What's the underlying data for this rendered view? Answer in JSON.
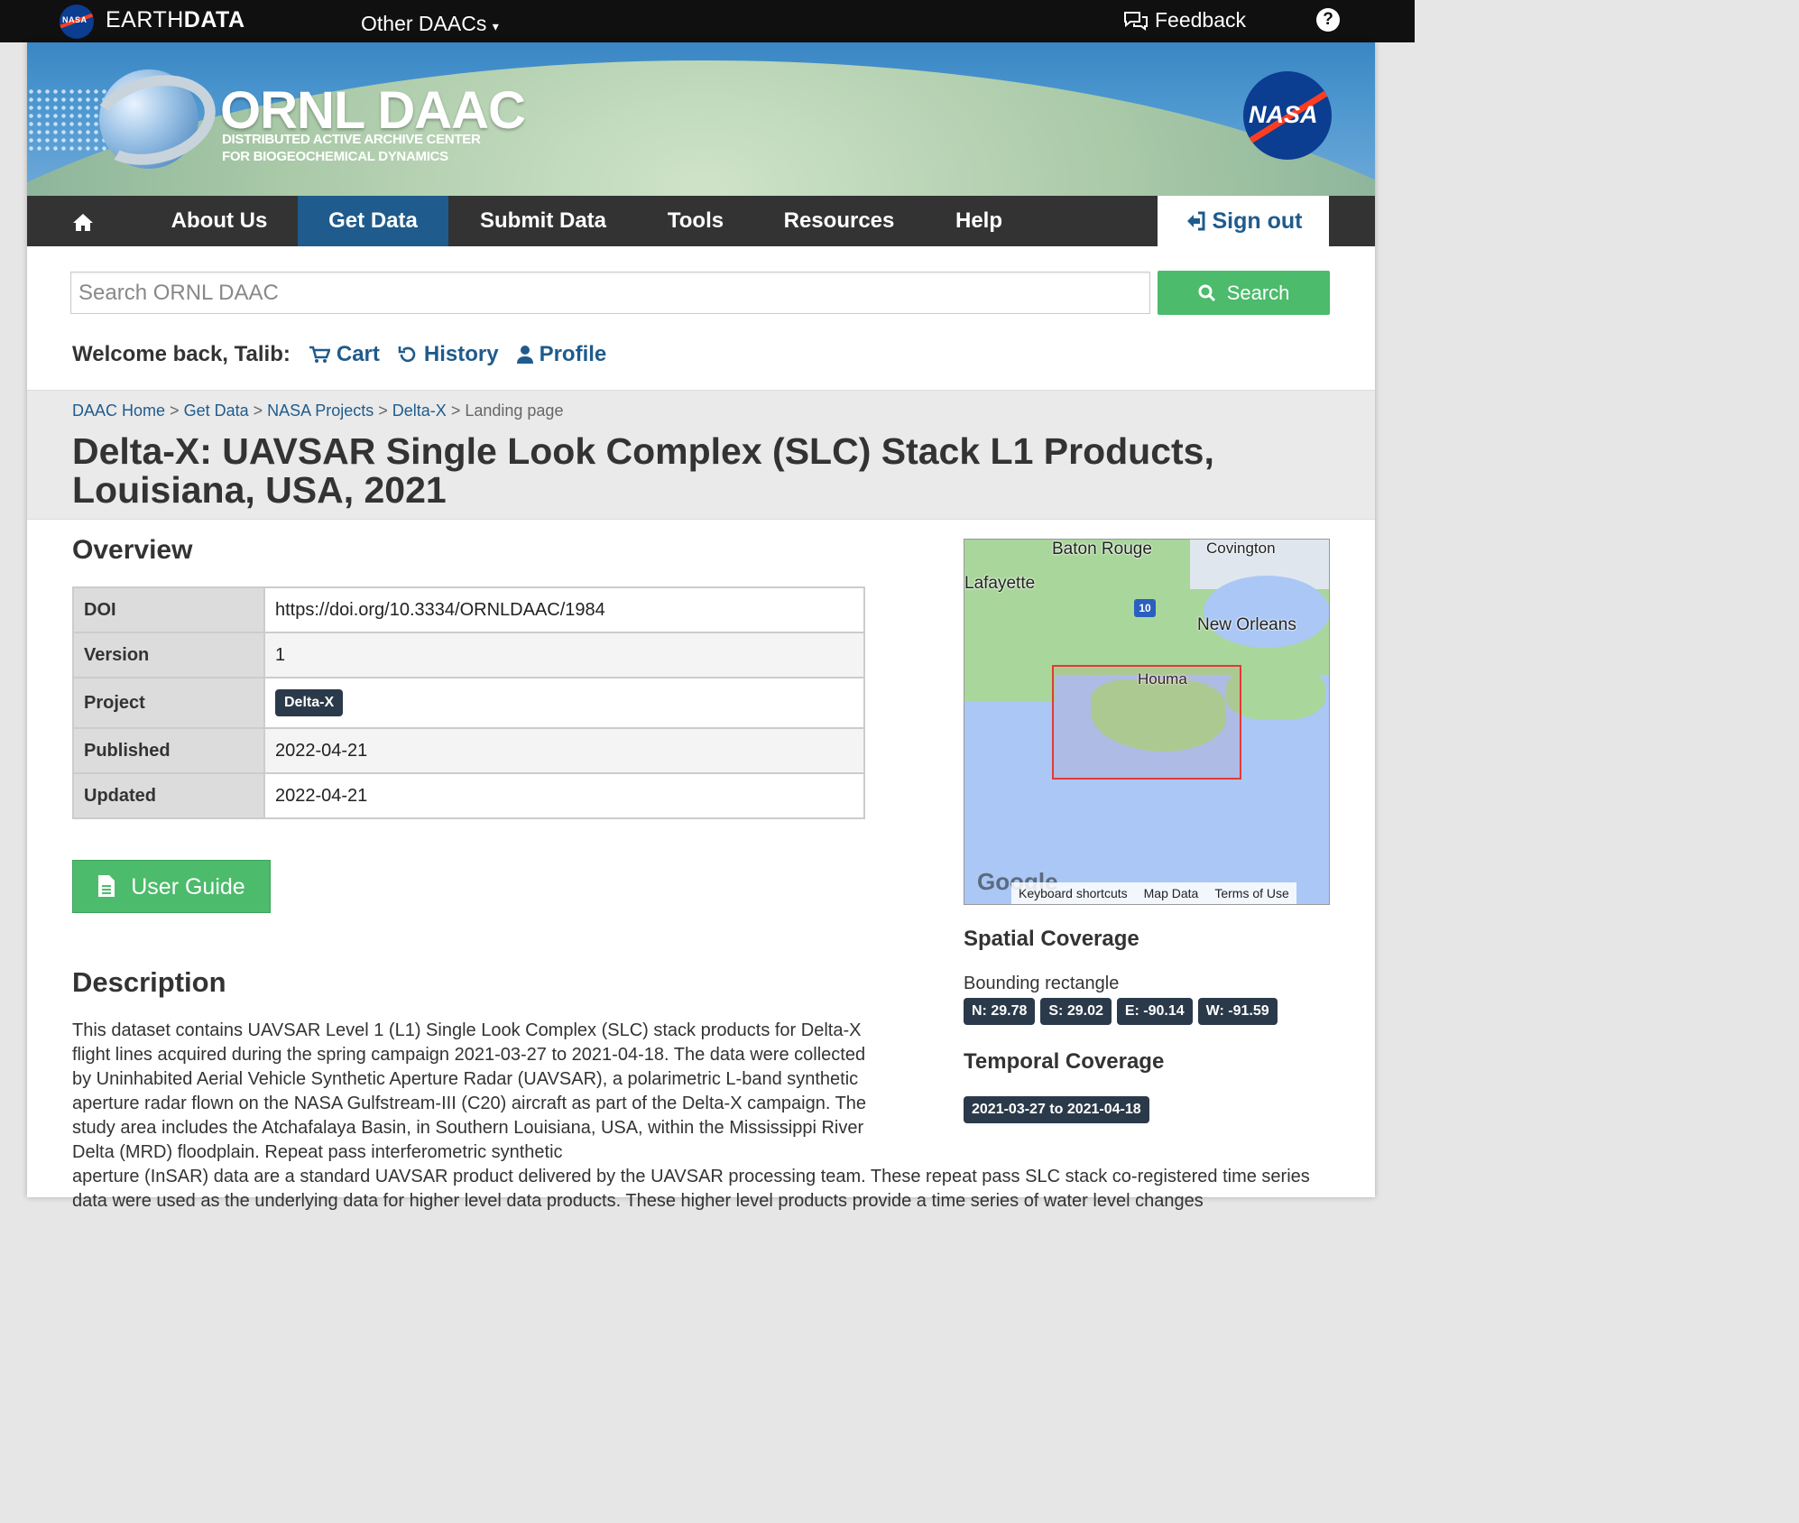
{
  "topbar": {
    "brand_regular": "EARTH",
    "brand_bold": "DATA",
    "nasa_small": "NASA",
    "other_daacs": "Other DAACs",
    "feedback": "Feedback",
    "help": "?"
  },
  "banner": {
    "title": "ORNL DAAC",
    "subtitle_line1": "DISTRIBUTED ACTIVE ARCHIVE CENTER",
    "subtitle_line2": "FOR BIOGEOCHEMICAL DYNAMICS",
    "nasa": "NASA"
  },
  "nav": {
    "items": [
      "About Us",
      "Get Data",
      "Submit Data",
      "Tools",
      "Resources",
      "Help"
    ],
    "active": "Get Data",
    "sign_out": "Sign out"
  },
  "search": {
    "placeholder": "Search ORNL DAAC",
    "button": "Search"
  },
  "user": {
    "welcome": "Welcome back, Talib:",
    "cart": "Cart",
    "history": "History",
    "profile": "Profile"
  },
  "breadcrumb": {
    "items": [
      "DAAC Home",
      "Get Data",
      "NASA Projects",
      "Delta-X"
    ],
    "current": "Landing page",
    "separator": ">"
  },
  "page_title": "Delta-X: UAVSAR Single Look Complex (SLC) Stack L1 Products, Louisiana, USA, 2021",
  "overview": {
    "heading": "Overview",
    "rows": [
      {
        "key": "DOI",
        "value": "https://doi.org/10.3334/ORNLDAAC/1984"
      },
      {
        "key": "Version",
        "value": "1"
      },
      {
        "key": "Project",
        "value": "Delta-X"
      },
      {
        "key": "Published",
        "value": "2022-04-21"
      },
      {
        "key": "Updated",
        "value": "2022-04-21"
      }
    ],
    "user_guide": "User Guide"
  },
  "description": {
    "heading": "Description",
    "text_part1": "This dataset contains UAVSAR Level 1 (L1) Single Look Complex (SLC) stack products for Delta-X flight lines acquired during the spring campaign 2021-03-27 to 2021-04-18. The data were collected by Uninhabited Aerial Vehicle Synthetic Aperture Radar (UAVSAR), a polarimetric L-band synthetic aperture radar flown on the NASA Gulfstream-III (C20) aircraft as part of the Delta-X campaign. The study area includes the Atchafalaya Basin, in Southern Louisiana, USA, within the Mississippi River Delta (MRD) floodplain. Repeat pass interferometric synthetic",
    "text_part2": "aperture (InSAR) data are a standard UAVSAR product delivered by the UAVSAR processing team. These repeat pass SLC stack co-registered time series data were used as the underlying data for higher level data products. These higher level products provide a time series of water level changes"
  },
  "map": {
    "places": [
      "Baton Rouge",
      "Covington",
      "Lafayette",
      "New Orleans",
      "Houma"
    ],
    "highway": "10",
    "google": "Google",
    "footer": [
      "Keyboard shortcuts",
      "Map Data",
      "Terms of Use"
    ]
  },
  "spatial": {
    "heading": "Spatial Coverage",
    "label": "Bounding rectangle",
    "north": "N: 29.78",
    "south": "S: 29.02",
    "east": "E: -90.14",
    "west": "W: -91.59"
  },
  "temporal": {
    "heading": "Temporal Coverage",
    "range": "2021-03-27 to 2021-04-18"
  }
}
